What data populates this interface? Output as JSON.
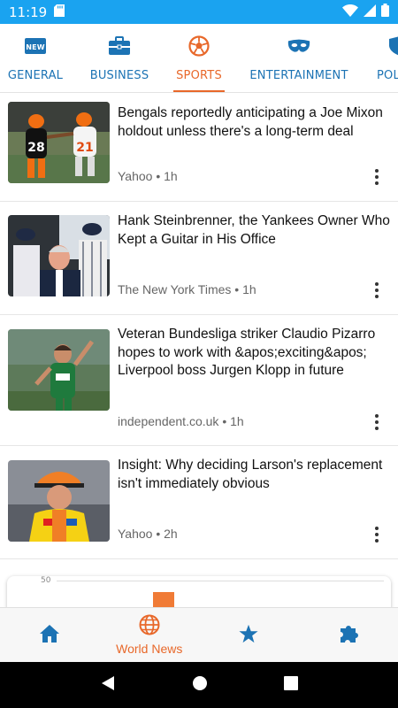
{
  "status_bar": {
    "time": "11:19"
  },
  "tabs": [
    {
      "label": "GENERAL",
      "icon": "newspaper-new-icon",
      "active": false
    },
    {
      "label": "BUSINESS",
      "icon": "briefcase-icon",
      "active": false
    },
    {
      "label": "SPORTS",
      "icon": "soccer-ball-icon",
      "active": true
    },
    {
      "label": "ENTERTAINMENT",
      "icon": "mask-icon",
      "active": false
    },
    {
      "label": "POL",
      "icon": "shield-icon",
      "active": false
    }
  ],
  "articles": [
    {
      "headline": "Bengals reportedly anticipating a Joe Mixon holdout unless there's a long-term deal",
      "source": "Yahoo",
      "age": "1h"
    },
    {
      "headline": "Hank Steinbrenner, the Yankees Owner Who Kept a Guitar in His Office",
      "source": "The New York Times",
      "age": "1h"
    },
    {
      "headline": "Veteran Bundesliga striker Claudio Pizarro hopes to work with &apos;exciting&apos; Liverpool boss Jurgen Klopp in future",
      "source": "independent.co.uk",
      "age": "1h"
    },
    {
      "headline": "Insight: Why deciding Larson's replacement isn't immediately obvious",
      "source": "Yahoo",
      "age": "2h"
    }
  ],
  "chart_preview": {
    "tick_label": "50"
  },
  "bottom_nav": [
    {
      "label": "",
      "icon": "home-icon",
      "active": false
    },
    {
      "label": "World News",
      "icon": "globe-icon",
      "active": true
    },
    {
      "label": "",
      "icon": "star-icon",
      "active": false
    },
    {
      "label": "",
      "icon": "puzzle-icon",
      "active": false
    }
  ],
  "colors": {
    "status_bar": "#1aa3f0",
    "accent": "#e8682a",
    "primary": "#1c73b4"
  }
}
